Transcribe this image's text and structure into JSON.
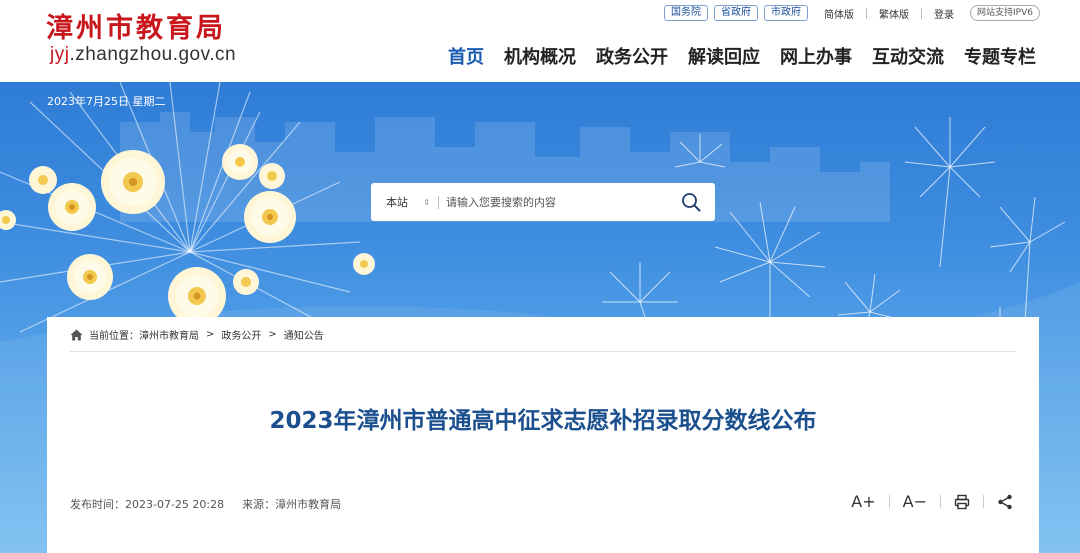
{
  "site": {
    "title": "漳州市教育局",
    "url_prefix": "jyj",
    "url_rest": ".zhangzhou.gov.cn"
  },
  "toplinks": {
    "gov_links": [
      "国务院",
      "省政府",
      "市政府"
    ],
    "simplified": "简体版",
    "traditional": "繁体版",
    "login": "登录",
    "ipv6": "网站支持IPV6"
  },
  "nav": {
    "items": [
      "首页",
      "机构概况",
      "政务公开",
      "解读回应",
      "网上办事",
      "互动交流",
      "专题专栏"
    ],
    "active_index": 0
  },
  "banner": {
    "date": "2023年7月25日 星期二"
  },
  "search": {
    "scope": "本站",
    "placeholder": "请输入您要搜索的内容"
  },
  "breadcrumb": {
    "prefix": "当前位置：",
    "items": [
      "漳州市教育局",
      "政务公开",
      "通知公告"
    ]
  },
  "article": {
    "title": "2023年漳州市普通高中征求志愿补招录取分数线公布",
    "publish_time": "发布时间：2023-07-25 20:28",
    "source": "来源：漳州市教育局"
  },
  "tools": {
    "font_larger": "A+",
    "font_smaller": "A−"
  },
  "colors": {
    "brand_red": "#c8161d",
    "nav_active": "#1a5bb0",
    "title_blue": "#1c4f8e",
    "banner_blue": "#3f8ee0"
  },
  "icons": [
    "home-icon",
    "search-icon",
    "print-icon",
    "share-icon",
    "flower-icon",
    "dandelion-icon"
  ]
}
